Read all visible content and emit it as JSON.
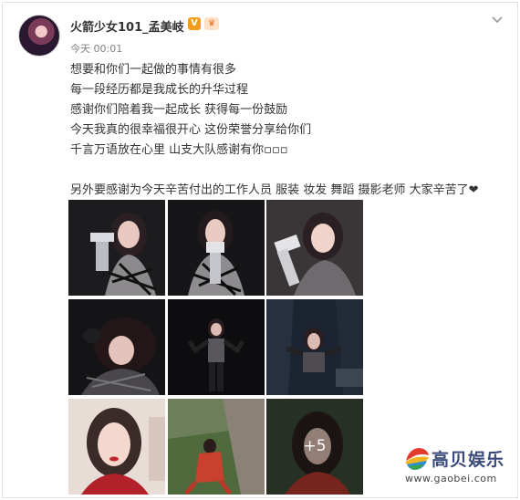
{
  "post": {
    "username": "火箭少女101_孟美岐",
    "vip_badge": "V",
    "level_badge": "ᵛ",
    "timestamp": "今天 00:01",
    "lines": [
      "想要和你们一起做的事情有很多",
      "每一段经历都是我成长的升华过程",
      "感谢你们陪着我一起成长 获得每一份鼓励",
      "今天我真的很幸福很开心 这份荣誉分享给你们",
      "千言万语放在心里 山支大队感谢有你▫▫▫",
      "",
      "另外要感谢为今天辛苦付出的工作人员 服装 妆发 舞蹈 摄影老师 大家辛苦了❤"
    ],
    "more_photos": "+5"
  },
  "icons": {
    "menu": "chevron-down-icon",
    "watermark_logo": "gaobei-logo-icon"
  },
  "colors": {
    "text": "#333333",
    "meta": "#808080",
    "vip": "#f49b1a"
  },
  "watermark": {
    "title": "高贝娱乐",
    "url": "www.gaobei.com"
  }
}
